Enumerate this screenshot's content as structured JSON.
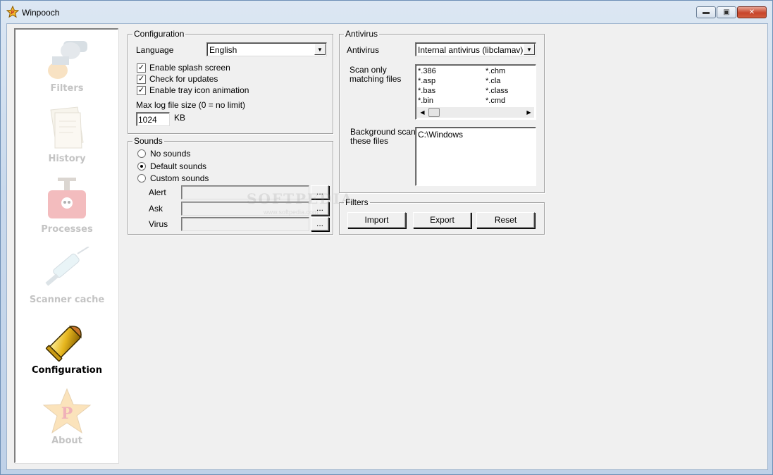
{
  "window": {
    "title": "Winpooch"
  },
  "sidebar": {
    "items": [
      {
        "label": "Filters",
        "icon": "gun-icon",
        "active": false
      },
      {
        "label": "History",
        "icon": "papers-icon",
        "active": false
      },
      {
        "label": "Processes",
        "icon": "dynamite-icon",
        "active": false
      },
      {
        "label": "Scanner cache",
        "icon": "syringe-icon",
        "active": false
      },
      {
        "label": "Configuration",
        "icon": "bullet-icon",
        "active": true
      },
      {
        "label": "About",
        "icon": "star-icon",
        "active": false
      }
    ]
  },
  "configuration": {
    "legend": "Configuration",
    "language_label": "Language",
    "language_value": "English",
    "checks": [
      {
        "label": "Enable splash screen",
        "checked": true
      },
      {
        "label": "Check for updates",
        "checked": true
      },
      {
        "label": "Enable tray icon animation",
        "checked": true
      }
    ],
    "maxlog_label": "Max log file size (0 = no limit)",
    "maxlog_value": "1024",
    "maxlog_unit": "KB"
  },
  "sounds": {
    "legend": "Sounds",
    "options": [
      {
        "label": "No sounds",
        "selected": false
      },
      {
        "label": "Default sounds",
        "selected": true
      },
      {
        "label": "Custom sounds",
        "selected": false
      }
    ],
    "rows": [
      {
        "label": "Alert",
        "browse": "..."
      },
      {
        "label": "Ask",
        "browse": "..."
      },
      {
        "label": "Virus",
        "browse": "..."
      }
    ]
  },
  "antivirus": {
    "legend": "Antivirus",
    "engine_label": "Antivirus",
    "engine_value": "Internal antivirus (libclamav)",
    "scan_label_1": "Scan only",
    "scan_label_2": "matching files",
    "extensions_col1": [
      "*.386",
      "*.asp",
      "*.bas",
      "*.bin"
    ],
    "extensions_col2": [
      "*.chm",
      "*.cla",
      "*.class",
      "*.cmd"
    ],
    "bg_label_1": "Background scan",
    "bg_label_2": "these files",
    "bg_value": "C:\\Windows"
  },
  "filters": {
    "legend": "Filters",
    "import": "Import",
    "export": "Export",
    "reset": "Reset"
  },
  "watermark": {
    "main": "SOFTPEDIA",
    "sub": "www.softpedia.com"
  }
}
